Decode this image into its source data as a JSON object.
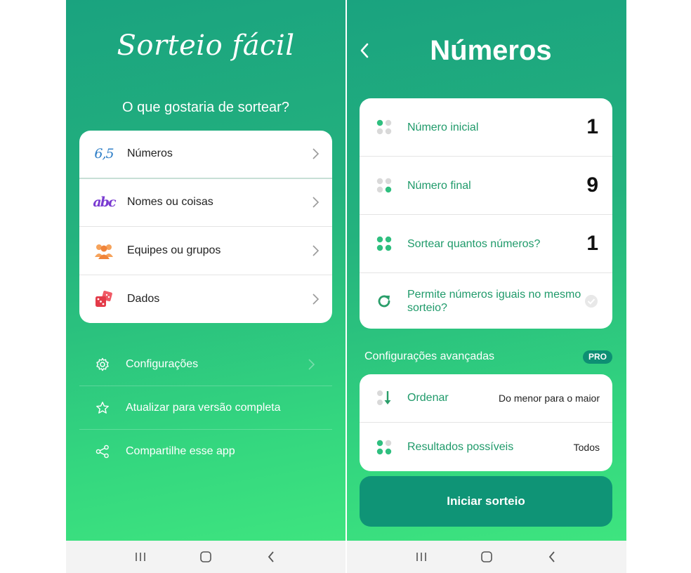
{
  "left": {
    "app_title": "Sorteio fácil",
    "question": "O que gostaria de sortear?",
    "menu": [
      {
        "label": "Números",
        "icon": "numbers-icon"
      },
      {
        "label": "Nomes ou coisas",
        "icon": "abc-icon"
      },
      {
        "label": "Equipes ou grupos",
        "icon": "people-icon"
      },
      {
        "label": "Dados",
        "icon": "dice-icon"
      }
    ],
    "options": [
      {
        "label": "Configurações",
        "icon": "gear-icon"
      },
      {
        "label": "Atualizar para versão completa",
        "icon": "star-icon"
      },
      {
        "label": "Compartilhe esse app",
        "icon": "share-icon"
      }
    ],
    "numbers_icon_text": "6,5",
    "abc_icon_text": "abc"
  },
  "right": {
    "title": "Números",
    "params": [
      {
        "label": "Número inicial",
        "value": "1"
      },
      {
        "label": "Número final",
        "value": "9"
      },
      {
        "label": "Sortear quantos números?",
        "value": "1"
      },
      {
        "label": "Permite números iguais no mesmo sorteio?"
      }
    ],
    "advanced_label": "Configurações avançadas",
    "pro_badge": "PRO",
    "advanced": [
      {
        "label": "Ordenar",
        "value": "Do menor para o maior"
      },
      {
        "label": "Resultados possíveis",
        "value": "Todos"
      }
    ],
    "start_button": "Iniciar sorteio"
  },
  "colors": {
    "accent": "#1f9a6a",
    "button": "#0f9476",
    "gradient_top": "#1aa37f",
    "gradient_bottom": "#3ee47f"
  }
}
